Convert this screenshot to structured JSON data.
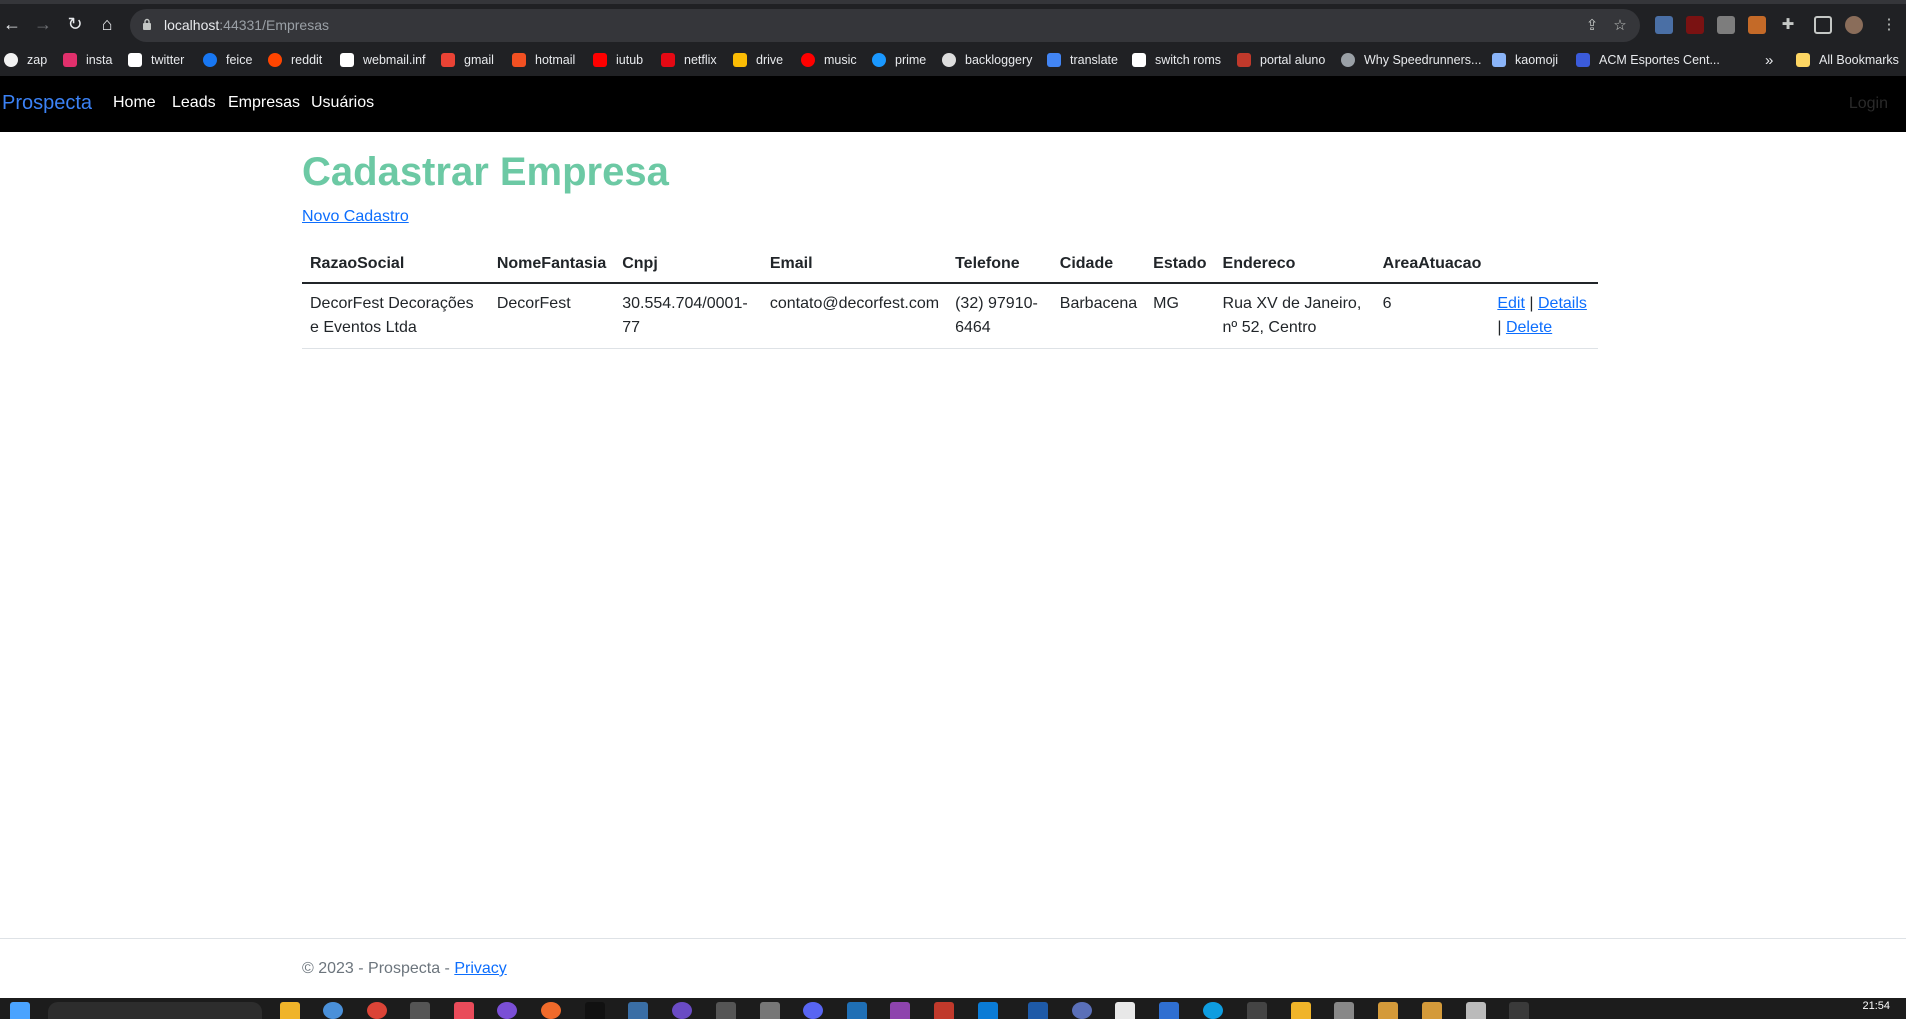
{
  "browser": {
    "url_host": "localhost",
    "url_rest": ":44331/Empresas",
    "bookmarks": [
      "zap",
      "insta",
      "twitter",
      "feice",
      "reddit",
      "webmail.inf",
      "gmail",
      "hotmail",
      "iutub",
      "netflix",
      "drive",
      "music",
      "prime",
      "backloggery",
      "translate",
      "switch roms",
      "portal aluno",
      "Why Speedrunners...",
      "kaomoji",
      "ACM Esportes Cent..."
    ],
    "overflow": "»",
    "all_bookmarks": "All Bookmarks",
    "colors": {
      "toolbar": "#202124",
      "omnibox": "#35363a"
    }
  },
  "appnav": {
    "brand": "Prospecta",
    "links": [
      "Home",
      "Leads",
      "Empresas",
      "Usuários"
    ],
    "login": "Login"
  },
  "main": {
    "title": "Cadastrar Empresa",
    "new_link": "Novo Cadastro",
    "columns": [
      "RazaoSocial",
      "NomeFantasia",
      "Cnpj",
      "Email",
      "Telefone",
      "Cidade",
      "Estado",
      "Endereco",
      "AreaAtuacao"
    ],
    "rows": [
      {
        "razao_social": "DecorFest Decorações e Eventos Ltda",
        "nome_fantasia": "DecorFest",
        "cnpj": "30.554.704/0001-77",
        "email": "contato@decorfest.com",
        "telefone": "(32) 97910-6464",
        "cidade": "Barbacena",
        "estado": "MG",
        "endereco": "Rua XV de Janeiro, nº 52, Centro",
        "area_atuacao": "6",
        "edit": "Edit",
        "details": "Details",
        "delete": "Delete",
        "separator": "|"
      }
    ]
  },
  "footer": {
    "text": "© 2023 - Prospecta - ",
    "privacy": "Privacy"
  },
  "taskbar": {
    "clock": "21:54"
  }
}
